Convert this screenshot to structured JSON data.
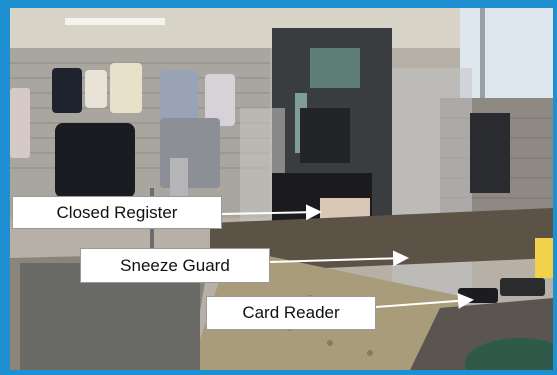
{
  "annotations": {
    "closed_register": "Closed Register",
    "sneeze_guard": "Sneeze Guard",
    "card_reader": "Card Reader"
  },
  "colors": {
    "border": "#1e8fd0",
    "label_background": "#ffffff",
    "arrow": "#ffffff"
  }
}
